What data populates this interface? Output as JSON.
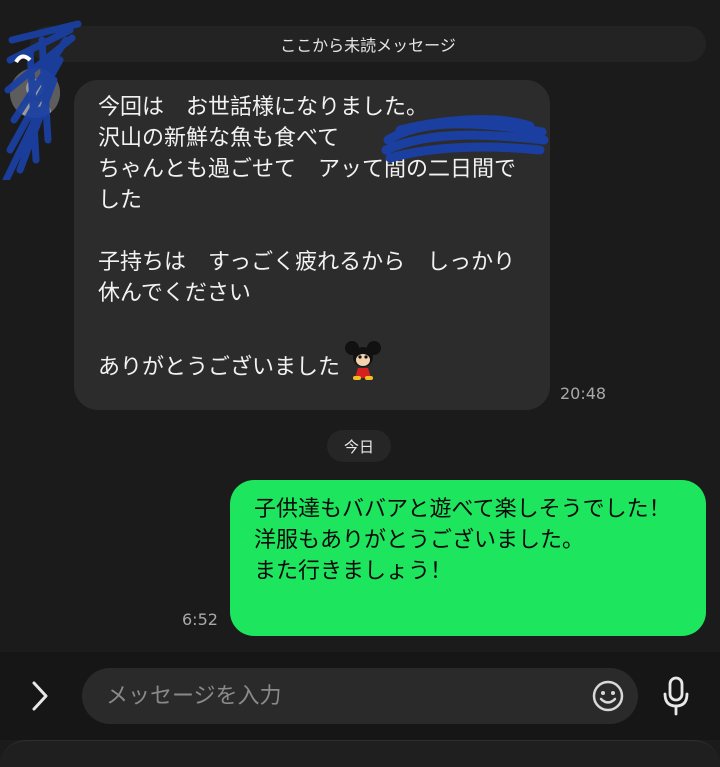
{
  "banner": {
    "unread_label": "ここから未読メッセージ"
  },
  "incoming": {
    "text": "今回は　お世話様になりました。\n沢山の新鮮な魚も食べて\nちゃんとも過ごせて　アッて間の二日間でした\n\n子持ちは　すっごく疲れるから　しっかり休んでください\n\nありがとうございました",
    "emoji": "mickey-mouse-icon",
    "time": "20:48"
  },
  "date_divider": {
    "label": "今日"
  },
  "outgoing": {
    "text": "子供達もババアと遊べて楽しそうでした！　洋服もありがとうございました。\nまた行きましょう！",
    "time": "6:52"
  },
  "composer": {
    "placeholder": "メッセージを入力"
  },
  "colors": {
    "background": "#1b1b1b",
    "incoming_bubble": "#2c2c2c",
    "outgoing_bubble": "#1ee55e",
    "redaction_scribble": "#1a3fa0"
  }
}
